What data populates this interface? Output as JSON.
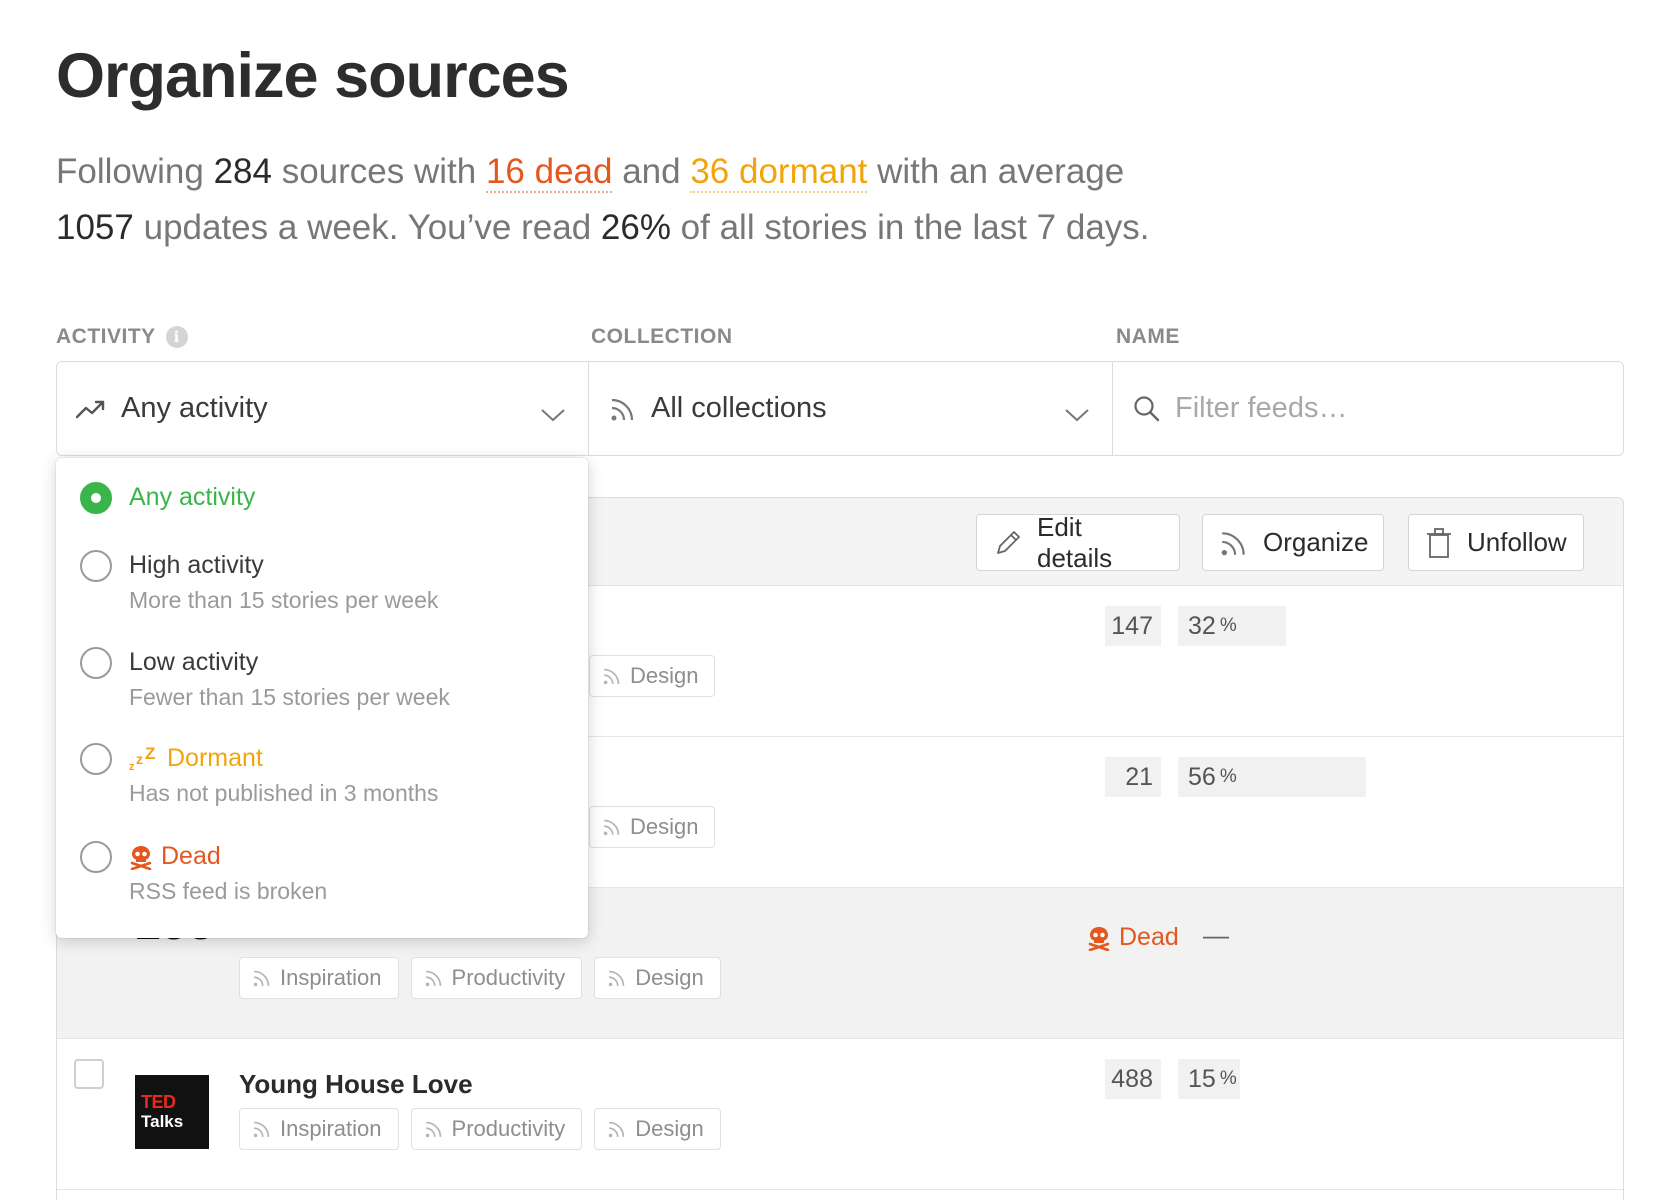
{
  "page": {
    "title": "Organize sources",
    "summary": {
      "p1": "Following ",
      "following_count": "284",
      "p2": " sources with ",
      "dead_link": "16 dead",
      "p3": " and ",
      "dormant_link": "36 dormant",
      "p4": " with an average ",
      "updates_count": "1057",
      "p5": " updates a week. You’ve read ",
      "read_pct": "26%",
      "p6": " of all stories in the last 7 days."
    }
  },
  "filters": {
    "activity": {
      "label": "ACTIVITY",
      "info_icon": "i",
      "value": "Any activity"
    },
    "collection": {
      "label": "COLLECTION",
      "value": "All collections"
    },
    "name": {
      "label": "NAME",
      "placeholder": "Filter feeds…"
    }
  },
  "toolbar": {
    "edit_label": "Edit details",
    "organize_label": "Organize",
    "unfollow_label": "Unfollow"
  },
  "feeds": [
    {
      "name": "",
      "tags": [
        "Design"
      ],
      "count": "147",
      "pct": "32",
      "pct_fill": 0.32,
      "selected": false
    },
    {
      "name": "",
      "tags": [
        "Design"
      ],
      "count": "21",
      "pct": "56",
      "pct_fill": 0.56,
      "selected": false
    },
    {
      "name": "",
      "logo_text": "zeen",
      "tags": [
        "Inspiration",
        "Productivity",
        "Design"
      ],
      "status": "Dead",
      "pct": "—",
      "selected": true
    },
    {
      "name": "Young House Love",
      "logo_line1": "TED",
      "logo_line2": "Talks",
      "tags": [
        "Inspiration",
        "Productivity",
        "Design"
      ],
      "count": "488",
      "pct": "15",
      "pct_fill": 0.15,
      "selected": false
    }
  ],
  "pct_unit": "%",
  "activity_dropdown": {
    "options": [
      {
        "label": "Any activity",
        "desc": "",
        "selected": true
      },
      {
        "label": "High activity",
        "desc": "More than 15 stories per week",
        "selected": false
      },
      {
        "label": "Low activity",
        "desc": "Fewer than 15 stories per week",
        "selected": false
      },
      {
        "label": "Dormant",
        "desc": "Has not published in 3 months",
        "icon": "zzz-icon",
        "selected": false
      },
      {
        "label": "Dead",
        "desc": "RSS feed is broken",
        "icon": "skull-icon",
        "selected": false
      }
    ]
  },
  "colors": {
    "accent_green": "#3ab54a",
    "dead_red": "#e4571f",
    "dormant_orange": "#f2a40c"
  }
}
